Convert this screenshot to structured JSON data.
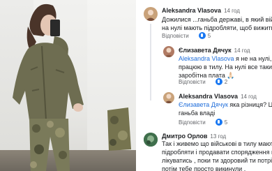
{
  "comments": [
    {
      "author": "Aleksandra Vlasova",
      "time": "14 год",
      "lines": [
        "Дожилися ...ганьба державі, в який війсь",
        "на нулі мають підробляти, щоб вижити."
      ],
      "reply_label": "Відповісти",
      "likes": "5",
      "avatar_color": "#c9a27a"
    },
    {
      "author": "Єлизавета Дячук",
      "time": "14 год",
      "mention": "Aleksandra Vlasova",
      "lines": [
        " я не на нулі, зар",
        "працюю в тилу. На нулі все таки ви",
        "заробітна плата 🙏🏻"
      ],
      "reply_label": "Відповісти",
      "likes": "2",
      "avatar_color": "#b07a63"
    },
    {
      "author": "Aleksandra Vlasova",
      "time": "14 год",
      "mention": "Єлизавета Дячук",
      "lines": [
        " яка різниця? Це",
        "ганьба владі"
      ],
      "reply_label": "Відповісти",
      "likes": "5",
      "avatar_color": "#c9a27a"
    },
    {
      "author": "Дмитро Орлов",
      "time": "13 год",
      "lines": [
        "Так і живемо що військові в тилу мають",
        "підробляти і продавати спорядження щ",
        "лікуватись , поки ти здоровий ти потріб",
        "потім тебе просто викинули ."
      ],
      "avatar_color": "#4a7a55"
    }
  ]
}
